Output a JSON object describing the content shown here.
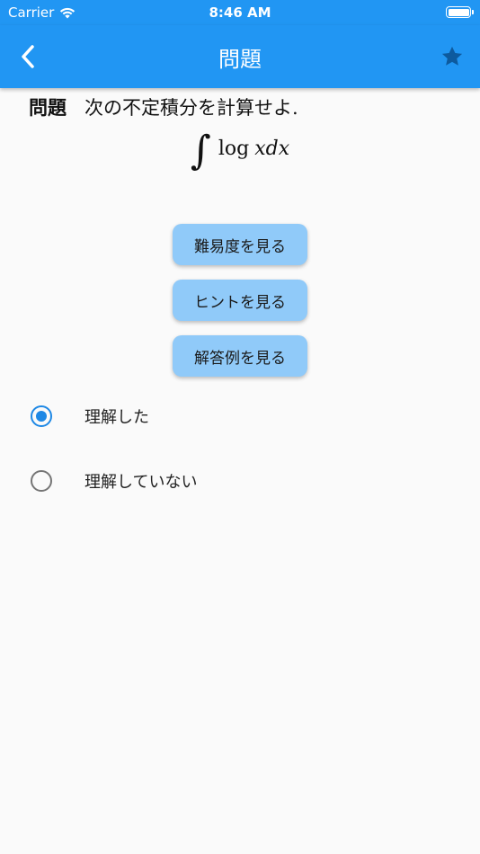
{
  "status_bar": {
    "carrier": "Carrier",
    "time": "8:46 AM",
    "wifi_icon": "wifi-icon",
    "battery_icon": "battery-icon"
  },
  "app_bar": {
    "title": "問題",
    "back_icon": "chevron-left-icon",
    "favorite_icon": "star-icon",
    "color": "#2196f3",
    "favorite_color": "#0d5a9e"
  },
  "problem": {
    "label": "問題",
    "text": "次の不定積分を計算せよ.",
    "formula": {
      "integral": "∫",
      "function": "log",
      "variables": "xdx"
    }
  },
  "buttons": {
    "difficulty": "難易度を見る",
    "hint": "ヒントを見る",
    "answer": "解答例を見る",
    "color": "#90caf9"
  },
  "understanding": {
    "selected": "understood",
    "options": [
      {
        "id": "understood",
        "label": "理解した",
        "checked": true
      },
      {
        "id": "not-understood",
        "label": "理解していない",
        "checked": false
      }
    ],
    "accent": "#1e88e5"
  }
}
